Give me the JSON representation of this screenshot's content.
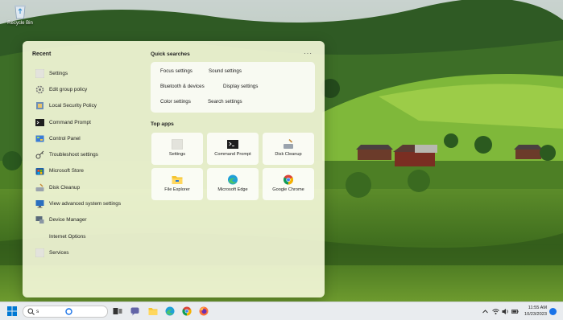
{
  "desktop": {
    "recycle_bin_label": "Recycle Bin"
  },
  "panel": {
    "recent_title": "Recent",
    "recent_items": [
      {
        "label": "Settings",
        "icon": "settings-tile-icon"
      },
      {
        "label": "Edit group policy",
        "icon": "group-policy-icon"
      },
      {
        "label": "Local Security Policy",
        "icon": "security-policy-icon"
      },
      {
        "label": "Command Prompt",
        "icon": "cmd-icon"
      },
      {
        "label": "Control Panel",
        "icon": "control-panel-icon"
      },
      {
        "label": "Troubleshoot settings",
        "icon": "key-icon"
      },
      {
        "label": "Microsoft Store",
        "icon": "store-icon"
      },
      {
        "label": "Disk Cleanup",
        "icon": "disk-cleanup-icon"
      },
      {
        "label": "View advanced system settings",
        "icon": "monitor-icon"
      },
      {
        "label": "Device Manager",
        "icon": "device-manager-icon"
      },
      {
        "label": "Internet Options",
        "icon": "none"
      },
      {
        "label": "Services",
        "icon": "services-icon"
      }
    ],
    "quick_searches_title": "Quick searches",
    "more_label": "···",
    "quick_searches": [
      "Focus settings",
      "Sound settings",
      "Bluetooth & devices",
      "Display settings",
      "Color settings",
      "Search settings"
    ],
    "top_apps_title": "Top apps",
    "top_apps": [
      {
        "label": "Settings",
        "icon": "settings-tile-icon"
      },
      {
        "label": "Command Prompt",
        "icon": "cmd-icon"
      },
      {
        "label": "Disk Cleanup",
        "icon": "disk-cleanup-icon"
      },
      {
        "label": "File Explorer",
        "icon": "folder-icon"
      },
      {
        "label": "Microsoft Edge",
        "icon": "edge-icon"
      },
      {
        "label": "Google Chrome",
        "icon": "chrome-icon"
      }
    ]
  },
  "taskbar": {
    "search_value": "s",
    "clock_time": "11:55 AM",
    "clock_date": "10/23/2023",
    "colors": {
      "accent": "#0078d4"
    }
  }
}
